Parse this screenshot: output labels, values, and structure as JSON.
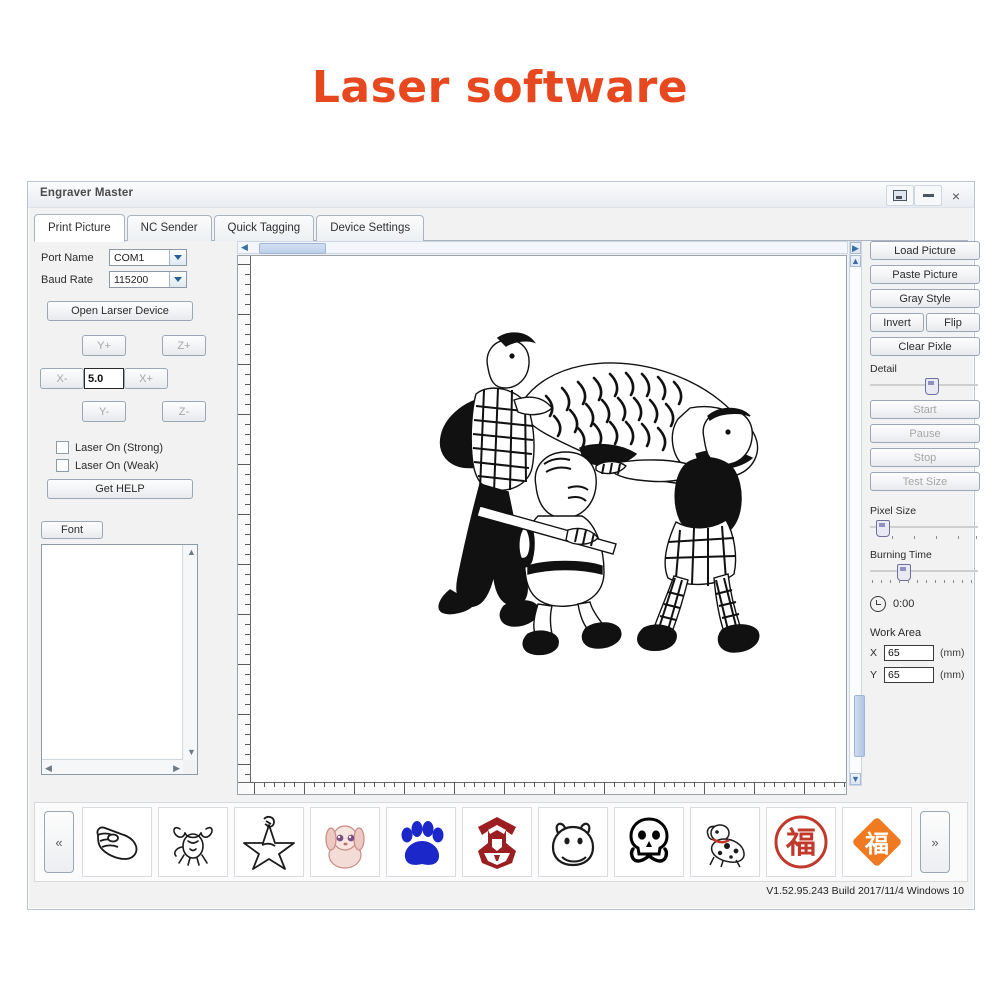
{
  "page": {
    "heading": "Laser software",
    "heading_color": "#e8481f"
  },
  "window": {
    "title": "Engraver Master",
    "controls": [
      {
        "name": "restore",
        "glyph": "restore-icon"
      },
      {
        "name": "minimize",
        "glyph": "minimize-icon"
      },
      {
        "name": "close",
        "glyph": "×"
      }
    ]
  },
  "tabs": [
    {
      "label": "Print Picture",
      "active": true
    },
    {
      "label": "NC Sender",
      "active": false
    },
    {
      "label": "Quick Tagging",
      "active": false
    },
    {
      "label": "Device Settings",
      "active": false
    }
  ],
  "left_panel": {
    "port_name_label": "Port Name",
    "port_name_value": "COM1",
    "baud_rate_label": "Baud Rate",
    "baud_rate_value": "115200",
    "open_device_label": "Open Larser Device",
    "jog": {
      "y_plus": "Y+",
      "z_plus": "Z+",
      "x_minus": "X-",
      "x_plus": "X+",
      "y_minus": "Y-",
      "z_minus": "Z-",
      "step_value": "5.0"
    },
    "checkboxes": [
      {
        "label": "Laser On (Strong)",
        "checked": false
      },
      {
        "label": "Laser On (Weak)",
        "checked": false
      }
    ],
    "get_help_label": "Get HELP",
    "font_button_label": "Font",
    "font_text_value": ""
  },
  "right_panel": {
    "load_picture": "Load Picture",
    "paste_picture": "Paste Picture",
    "gray_style": "Gray Style",
    "invert": "Invert",
    "flip": "Flip",
    "clear_pixel": "Clear Pixle",
    "detail_label": "Detail",
    "detail_value": 55,
    "start": "Start",
    "pause": "Pause",
    "stop": "Stop",
    "test_size": "Test Size",
    "pixel_size_label": "Pixel Size",
    "pixel_size_value": 6,
    "burning_time_label": "Burning Time",
    "burning_time_value": 22,
    "elapsed_time": "0:00",
    "work_area_label": "Work Area",
    "work_area": [
      {
        "axis": "X",
        "value": "65",
        "unit": "(mm)"
      },
      {
        "axis": "Y",
        "value": "65",
        "unit": "(mm)"
      }
    ]
  },
  "thumbnails": {
    "prev_label": "«",
    "next_label": "»",
    "items": [
      {
        "name": "pointing-hand-thumbnail"
      },
      {
        "name": "bull-sketch-thumbnail"
      },
      {
        "name": "star-sketch-thumbnail"
      },
      {
        "name": "puppy-girl-thumbnail"
      },
      {
        "name": "paw-print-thumbnail"
      },
      {
        "name": "autobot-logo-thumbnail"
      },
      {
        "name": "ghost-cow-thumbnail"
      },
      {
        "name": "skull-crossbones-thumbnail"
      },
      {
        "name": "dalmatian-thumbnail"
      },
      {
        "name": "fu-seal-round-thumbnail"
      },
      {
        "name": "fu-diamond-thumbnail"
      }
    ]
  },
  "status": {
    "version": "V1.52.95.243 Build 2017/11/4 Windows 10"
  }
}
